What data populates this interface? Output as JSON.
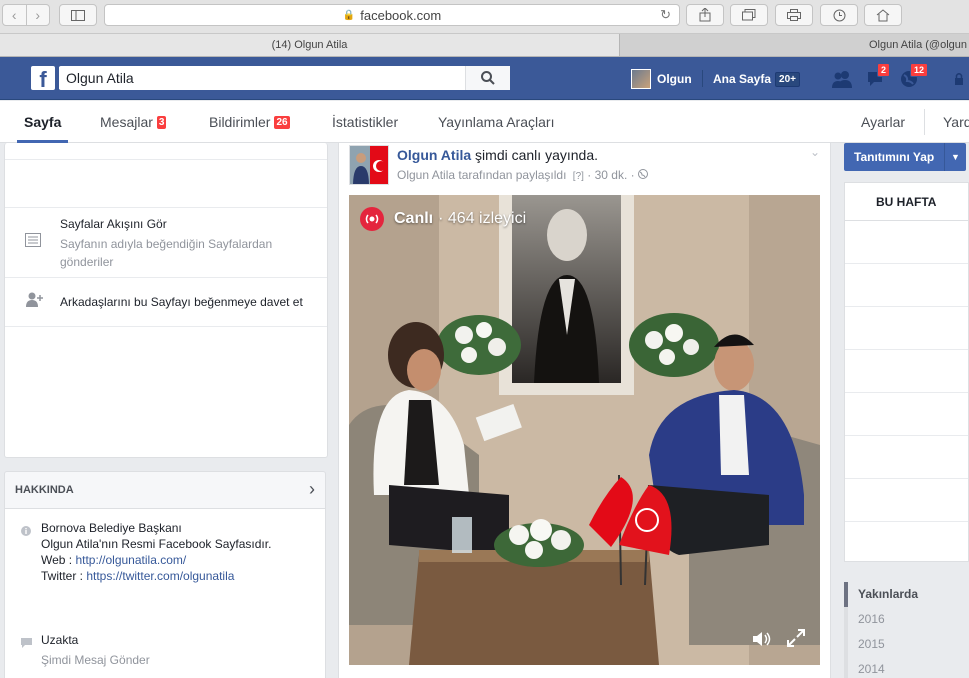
{
  "browser": {
    "url": "facebook.com",
    "tabs": [
      "(14) Olgun Atila",
      "Olgun Atila (@olgun"
    ]
  },
  "fb_header": {
    "logo": "f",
    "search_value": "Olgun Atila",
    "user_name": "Olgun",
    "home_label": "Ana Sayfa",
    "home_count": "20+",
    "friend_requests_icon": "friends-icon",
    "messages_badge": "2",
    "notifications_badge": "12",
    "brand_color": "#3b5998"
  },
  "page_tabs": {
    "items": [
      {
        "label": "Sayfa",
        "count": ""
      },
      {
        "label": "Mesajlar",
        "count": "3"
      },
      {
        "label": "Bildirimler",
        "count": "26"
      },
      {
        "label": "İstatistikler",
        "count": ""
      },
      {
        "label": "Yayınlama Araçları",
        "count": ""
      }
    ],
    "settings": "Ayarlar",
    "help": "Yard"
  },
  "left": {
    "feed_title": "Sayfalar Akışını Gör",
    "feed_desc": "Sayfanın adıyla beğendiğin Sayfalardan gönderiler",
    "invite": "Arkadaşlarını bu Sayfayı beğenmeye davet et",
    "about_header": "HAKKINDA",
    "about_line1": "Bornova Belediye Başkanı",
    "about_line2": "Olgun Atila'nın Resmi Facebook Sayfasıdır.",
    "web_label": "Web : ",
    "web_url": "http://olgunatila.com/",
    "twitter_label": "Twitter : ",
    "twitter_url": "https://twitter.com/olgunatila",
    "away_title": "Uzakta",
    "away_action": "Şimdi Mesaj Gönder"
  },
  "post": {
    "author": "Olgun Atila",
    "action": "şimdi canlı yayında.",
    "shared_by": "Olgun Atila tarafından paylaşıldı",
    "help_mark": "[?]",
    "time": "30 dk.",
    "live_label": "Canlı",
    "viewers": "· 464 izleyici"
  },
  "right": {
    "promote": "Tanıtımını Yap",
    "week_header": "BU HAFTA",
    "years": [
      "Yakınlarda",
      "2016",
      "2015",
      "2014"
    ]
  }
}
